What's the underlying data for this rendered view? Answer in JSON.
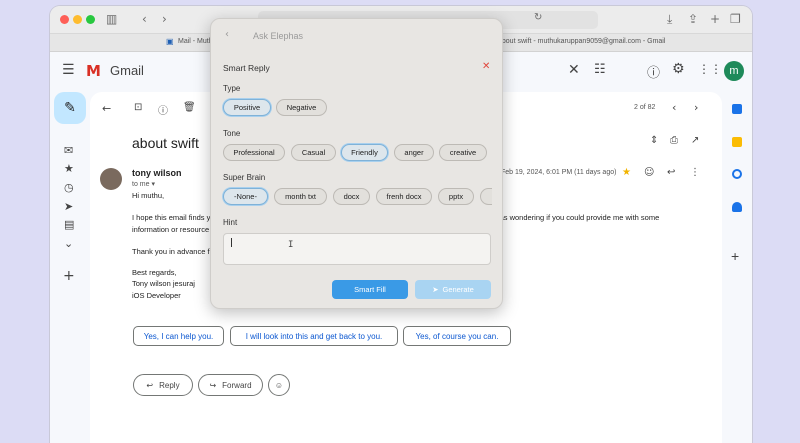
{
  "browser": {
    "tabs": [
      {
        "label": "Mail - Muth"
      },
      {
        "label": "about swift - muthukaruppan9059@gmail.com - Gmail"
      }
    ]
  },
  "gmail": {
    "logo_text": "Gmail",
    "pagination": "2 of 82",
    "avatar_letter": "m",
    "subject": "about swift",
    "sender_name": "tony wilson",
    "to_me": "to me",
    "date": "Feb 19, 2024, 6:01 PM (11 days ago)",
    "body": {
      "greeting": "Hi muthu,",
      "line1_left": "I hope this email finds y",
      "line1_right": "I was wondering if you could provide me with some",
      "line2": "information or resource",
      "thanks": "Thank you in advance f",
      "regards": "Best regards,",
      "sig_name": "Tony wilson jesuraj",
      "sig_title": "iOS Developer"
    },
    "smart_replies": [
      {
        "label": "Yes, I can help you."
      },
      {
        "label": "I will look into this and get back to you."
      },
      {
        "label": "Yes, of course you can."
      }
    ],
    "reply_label": "Reply",
    "forward_label": "Forward"
  },
  "dialog": {
    "title": "Ask Elephas",
    "heading": "Smart Reply",
    "type_label": "Type",
    "type_options": [
      {
        "label": "Positive",
        "selected": true
      },
      {
        "label": "Negative",
        "selected": false
      }
    ],
    "tone_label": "Tone",
    "tone_options": [
      {
        "label": "Professional",
        "selected": false
      },
      {
        "label": "Casual",
        "selected": false
      },
      {
        "label": "Friendly",
        "selected": true
      },
      {
        "label": "anger",
        "selected": false
      },
      {
        "label": "creative",
        "selected": false
      }
    ],
    "brain_label": "Super Brain",
    "brain_options": [
      {
        "label": "-None-",
        "selected": true
      },
      {
        "label": "month txt",
        "selected": false
      },
      {
        "label": "docx",
        "selected": false
      },
      {
        "label": "frenh docx",
        "selected": false
      },
      {
        "label": "pptx",
        "selected": false
      }
    ],
    "hint_label": "Hint",
    "hint_value": "",
    "smart_fill_label": "Smart Fill",
    "generate_label": "Generate"
  },
  "colors": {
    "accent": "#3a9ae6",
    "gmail_compose": "#c2e7ff",
    "selected_border": "#7fb2d8"
  }
}
